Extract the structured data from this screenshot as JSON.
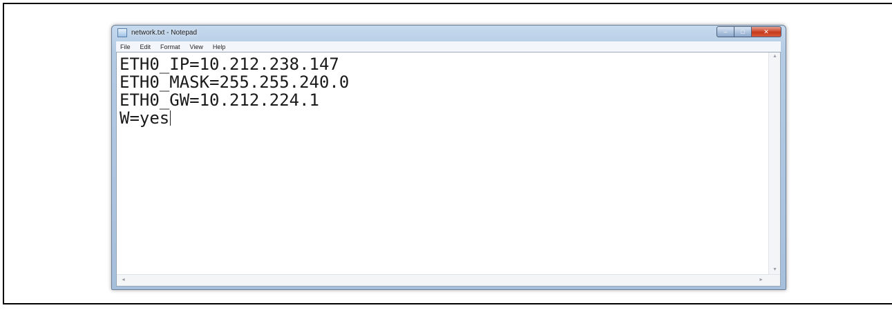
{
  "window": {
    "title": "network.txt - Notepad",
    "caption_min": "–",
    "caption_max": "□",
    "caption_close": "✕"
  },
  "menu": {
    "items": [
      "File",
      "Edit",
      "Format",
      "View",
      "Help"
    ]
  },
  "editor": {
    "lines": [
      "ETH0_IP=10.212.238.147",
      "ETH0_MASK=255.255.240.0",
      "ETH0_GW=10.212.224.1",
      "W=yes"
    ]
  },
  "icons": {
    "app": "notepad-icon",
    "scroll_up": "▲",
    "scroll_down": "▼",
    "scroll_left": "◄",
    "scroll_right": "►"
  }
}
